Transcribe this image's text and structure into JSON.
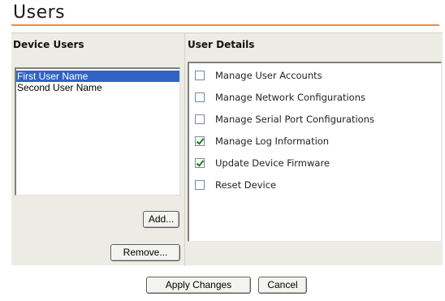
{
  "page": {
    "title": "Users"
  },
  "device_users": {
    "header": "Device Users",
    "items": [
      {
        "label": "First User Name",
        "selected": true
      },
      {
        "label": "Second User Name",
        "selected": false
      }
    ],
    "add_label": "Add...",
    "remove_label": "Remove..."
  },
  "user_details": {
    "header": "User Details",
    "permissions": [
      {
        "label": "Manage User Accounts",
        "checked": false
      },
      {
        "label": "Manage Network Configurations",
        "checked": false
      },
      {
        "label": "Manage Serial Port Configurations",
        "checked": false
      },
      {
        "label": "Manage Log Information",
        "checked": true
      },
      {
        "label": "Update Device Firmware",
        "checked": true
      },
      {
        "label": "Reset Device",
        "checked": false
      }
    ]
  },
  "footer": {
    "apply_label": "Apply Changes",
    "cancel_label": "Cancel"
  },
  "colors": {
    "accent_rule": "#f08c3a",
    "selection": "#3163c5",
    "panel_bg": "#ecebe4"
  }
}
